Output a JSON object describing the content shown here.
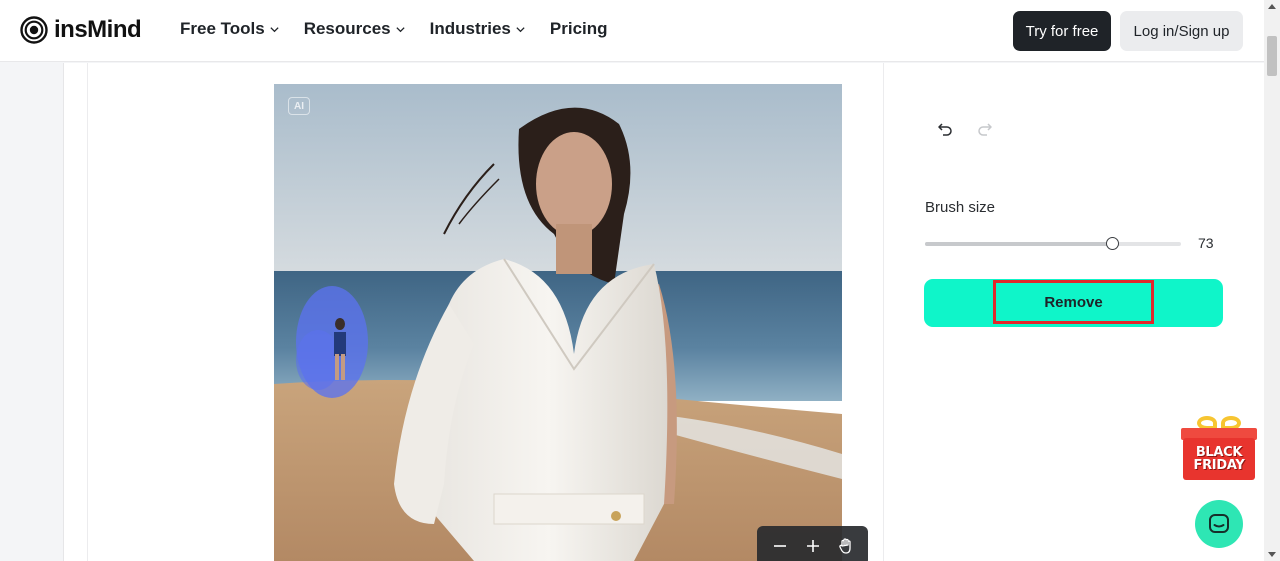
{
  "header": {
    "logo_text": "insMind",
    "nav": [
      {
        "label": "Free Tools",
        "has_dropdown": true
      },
      {
        "label": "Resources",
        "has_dropdown": true
      },
      {
        "label": "Industries",
        "has_dropdown": true
      },
      {
        "label": "Pricing",
        "has_dropdown": false
      }
    ],
    "try_label": "Try for free",
    "login_label": "Log in/Sign up"
  },
  "canvas": {
    "ai_badge": "AI",
    "zoom_controls": [
      "zoom-out-icon",
      "zoom-in-icon",
      "hand-icon"
    ]
  },
  "side": {
    "undo_icon": "undo-icon",
    "redo_icon": "redo-icon",
    "brush_label": "Brush size",
    "brush_value": "73",
    "brush_fraction": 0.73,
    "remove_label": "Remove"
  },
  "promo": {
    "line1": "BLACK",
    "line2": "FRIDAY"
  },
  "colors": {
    "remove_button": "#0ff5c9",
    "highlight_border": "#e3262b",
    "chat_button": "#2ee6b4",
    "dark_button": "#1f2328"
  }
}
